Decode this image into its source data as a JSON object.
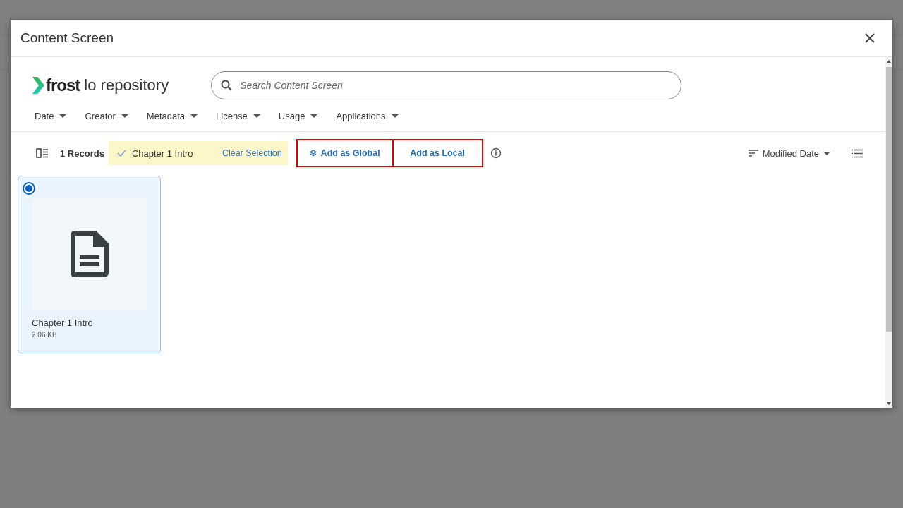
{
  "dialog": {
    "title": "Content Screen",
    "logo": {
      "brand": "frost",
      "product": "lo repository"
    },
    "search": {
      "placeholder": "Search Content Screen"
    },
    "filters": [
      "Date",
      "Creator",
      "Metadata",
      "License",
      "Usage",
      "Applications"
    ],
    "toolbar": {
      "records": "1 Records",
      "selection": "Chapter 1 Intro",
      "clear": "Clear Selection",
      "actions": [
        {
          "label": "Add as Global",
          "icon": true,
          "highlighted": true
        },
        {
          "label": "Add as Local",
          "icon": false,
          "highlighted": true
        }
      ],
      "sort": "Modified Date"
    },
    "items": [
      {
        "title": "Chapter 1 Intro",
        "size": "2.06 KB",
        "selected": true
      }
    ]
  }
}
